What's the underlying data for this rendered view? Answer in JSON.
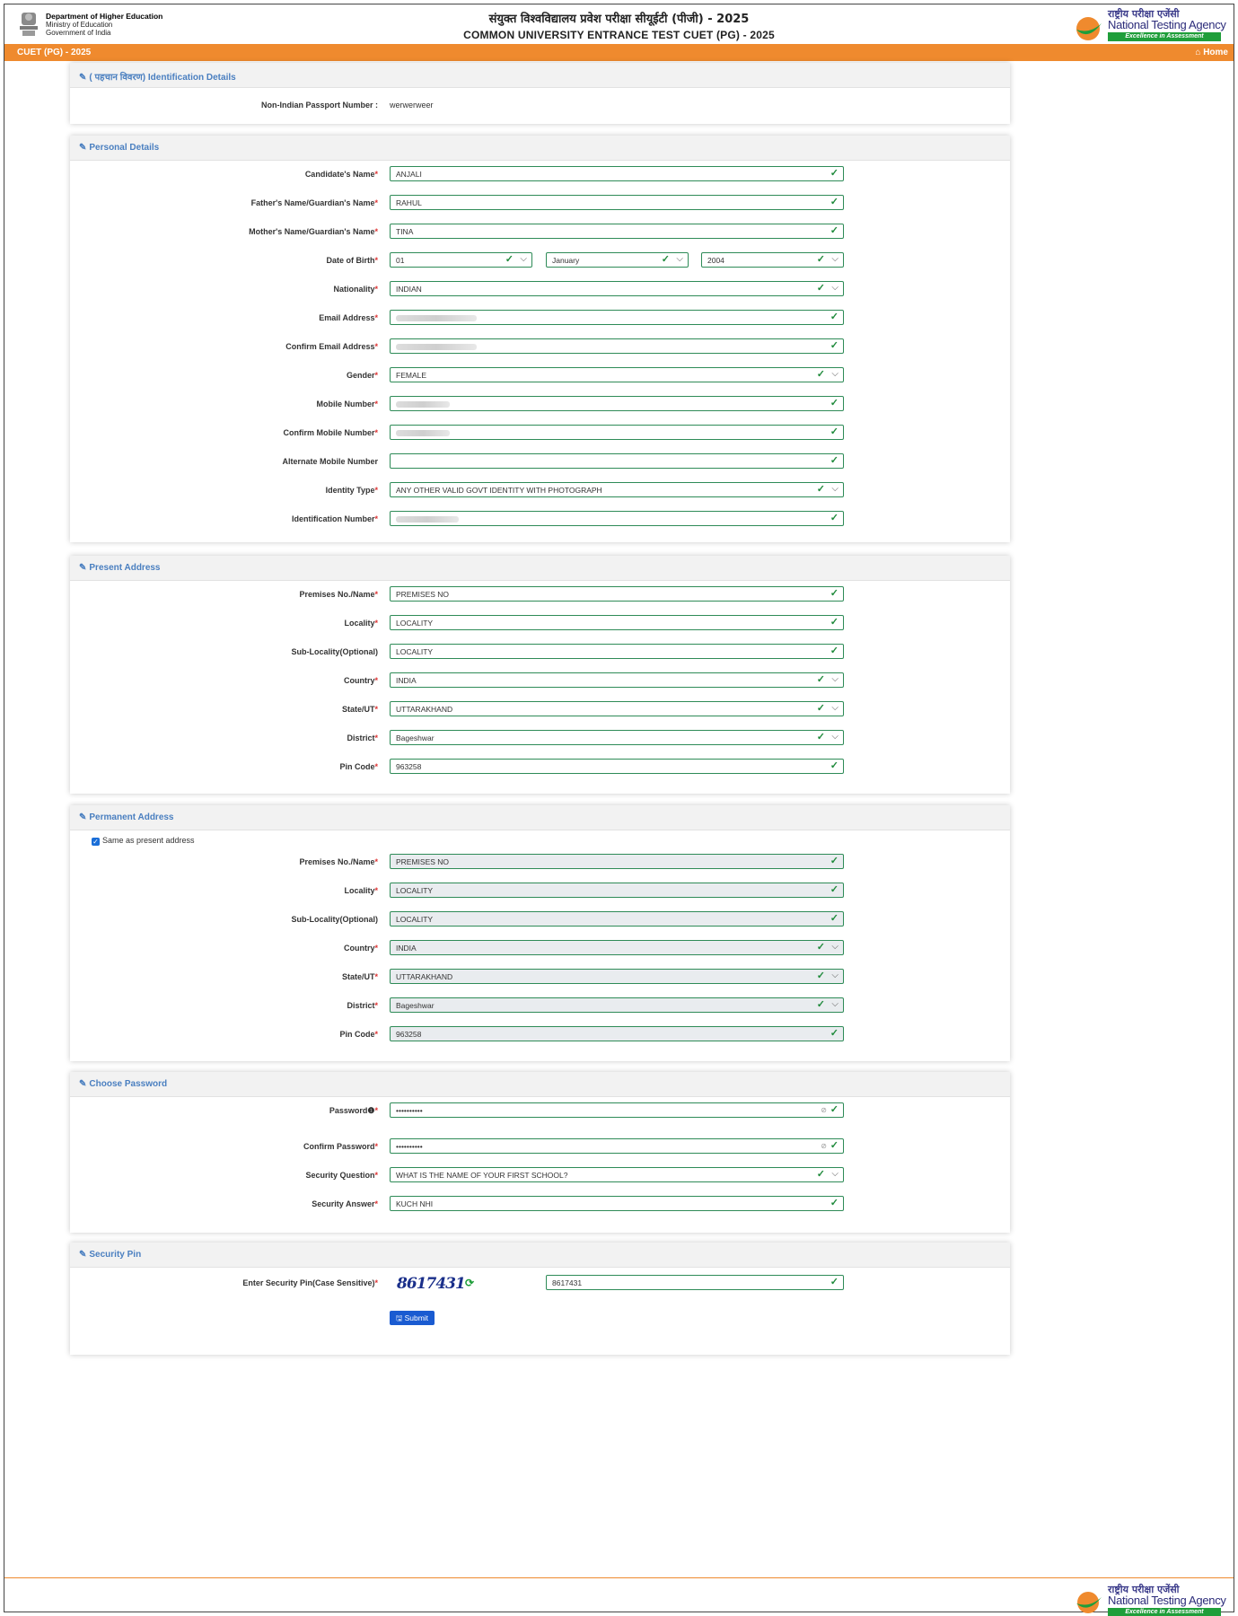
{
  "header": {
    "dept_line1": "Department of Higher Education",
    "dept_line2": "Ministry of Education",
    "dept_line3": "Government of India",
    "title_hindi": "संयुक्त विश्वविद्यालय प्रवेश परीक्षा सीयूईटी (पीजी) - 2025",
    "title_english": "COMMON UNIVERSITY ENTRANCE TEST CUET (PG) - 2025",
    "nta_hindi": "राष्ट्रीय परीक्षा एजेंसी",
    "nta_english": "National Testing Agency",
    "nta_tagline": "Excellence in Assessment"
  },
  "nav": {
    "left": "CUET (PG) - 2025",
    "home": "Home"
  },
  "identification": {
    "heading": "( पहचान विवरण) Identification Details",
    "passport_label": "Non-Indian Passport Number :",
    "passport_value": "werwerweer"
  },
  "personal": {
    "heading": "Personal Details",
    "candidate_label": "Candidate's Name",
    "candidate_value": "ANJALI",
    "father_label": "Father's Name/Guardian's Name",
    "father_value": "RAHUL",
    "mother_label": "Mother's Name/Guardian's Name",
    "mother_value": "TINA",
    "dob_label": "Date of Birth",
    "dob_day": "01",
    "dob_month": "January",
    "dob_year": "2004",
    "nationality_label": "Nationality",
    "nationality_value": "INDIAN",
    "email_label": "Email Address",
    "confirm_email_label": "Confirm Email Address",
    "gender_label": "Gender",
    "gender_value": "FEMALE",
    "mobile_label": "Mobile Number",
    "confirm_mobile_label": "Confirm Mobile Number",
    "alt_mobile_label": "Alternate Mobile Number",
    "identity_label": "Identity Type",
    "identity_value": "ANY OTHER VALID GOVT IDENTITY WITH PHOTOGRAPH",
    "id_number_label": "Identification Number"
  },
  "present": {
    "heading": "Present Address",
    "premises_label": "Premises No./Name",
    "premises_value": "PREMISES NO",
    "locality_label": "Locality",
    "locality_value": "LOCALITY",
    "sublocality_label": "Sub-Locality(Optional)",
    "sublocality_value": "LOCALITY",
    "country_label": "Country",
    "country_value": "INDIA",
    "state_label": "State/UT",
    "state_value": "UTTARAKHAND",
    "district_label": "District",
    "district_value": "Bageshwar",
    "pin_label": "Pin Code",
    "pin_value": "963258"
  },
  "permanent": {
    "heading": "Permanent Address",
    "same_label": "Same as present address",
    "premises_label": "Premises No./Name",
    "premises_value": "PREMISES NO",
    "locality_label": "Locality",
    "locality_value": "LOCALITY",
    "sublocality_label": "Sub-Locality(Optional)",
    "sublocality_value": "LOCALITY",
    "country_label": "Country",
    "country_value": "INDIA",
    "state_label": "State/UT",
    "state_value": "UTTARAKHAND",
    "district_label": "District",
    "district_value": "Bageshwar",
    "pin_label": "Pin Code",
    "pin_value": "963258"
  },
  "password": {
    "heading": "Choose Password",
    "password_label": "Password",
    "password_value": "••••••••••",
    "confirm_label": "Confirm Password",
    "confirm_value": "••••••••••",
    "question_label": "Security Question",
    "question_value": "WHAT IS THE NAME OF YOUR FIRST SCHOOL?",
    "answer_label": "Security Answer",
    "answer_value": "KUCH NHI"
  },
  "security_pin": {
    "heading": "Security Pin",
    "label": "Enter Security Pin(Case Sensitive)",
    "captcha": "8617431",
    "value": "8617431",
    "submit": "Submit"
  },
  "colors": {
    "accent": "#ef8a2e",
    "check": "#1f8a3b",
    "heading": "#4a7fc0",
    "button": "#1a5bd1"
  }
}
